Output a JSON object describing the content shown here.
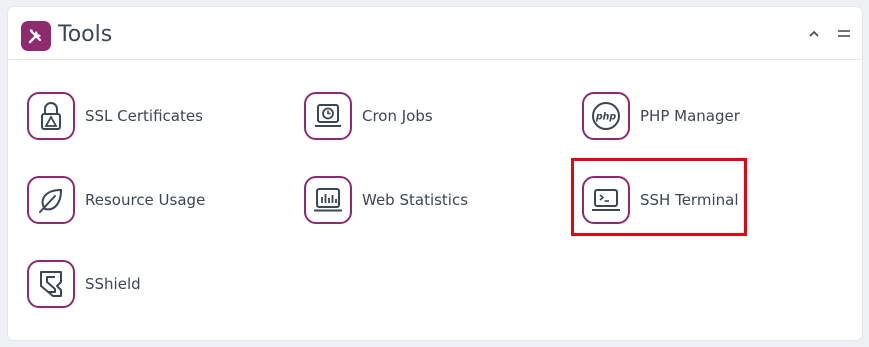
{
  "panel": {
    "title": "Tools",
    "header_icon": "tools-icon",
    "collapse_icon": "chevron-up-icon",
    "menu_icon": "hamburger-icon"
  },
  "tools": [
    {
      "label": "SSL Certificates",
      "icon": "ssl-lock-icon"
    },
    {
      "label": "Cron Jobs",
      "icon": "cron-clock-icon"
    },
    {
      "label": "PHP Manager",
      "icon": "php-icon"
    },
    {
      "label": "Resource Usage",
      "icon": "leaf-icon"
    },
    {
      "label": "Web Statistics",
      "icon": "statistics-chart-icon"
    },
    {
      "label": "SSH Terminal",
      "icon": "terminal-icon",
      "highlighted": true
    },
    {
      "label": "SShield",
      "icon": "sshield-icon"
    }
  ],
  "colors": {
    "accent": "#8e2b6f",
    "highlight": "#e30613",
    "text": "#3d4654"
  }
}
